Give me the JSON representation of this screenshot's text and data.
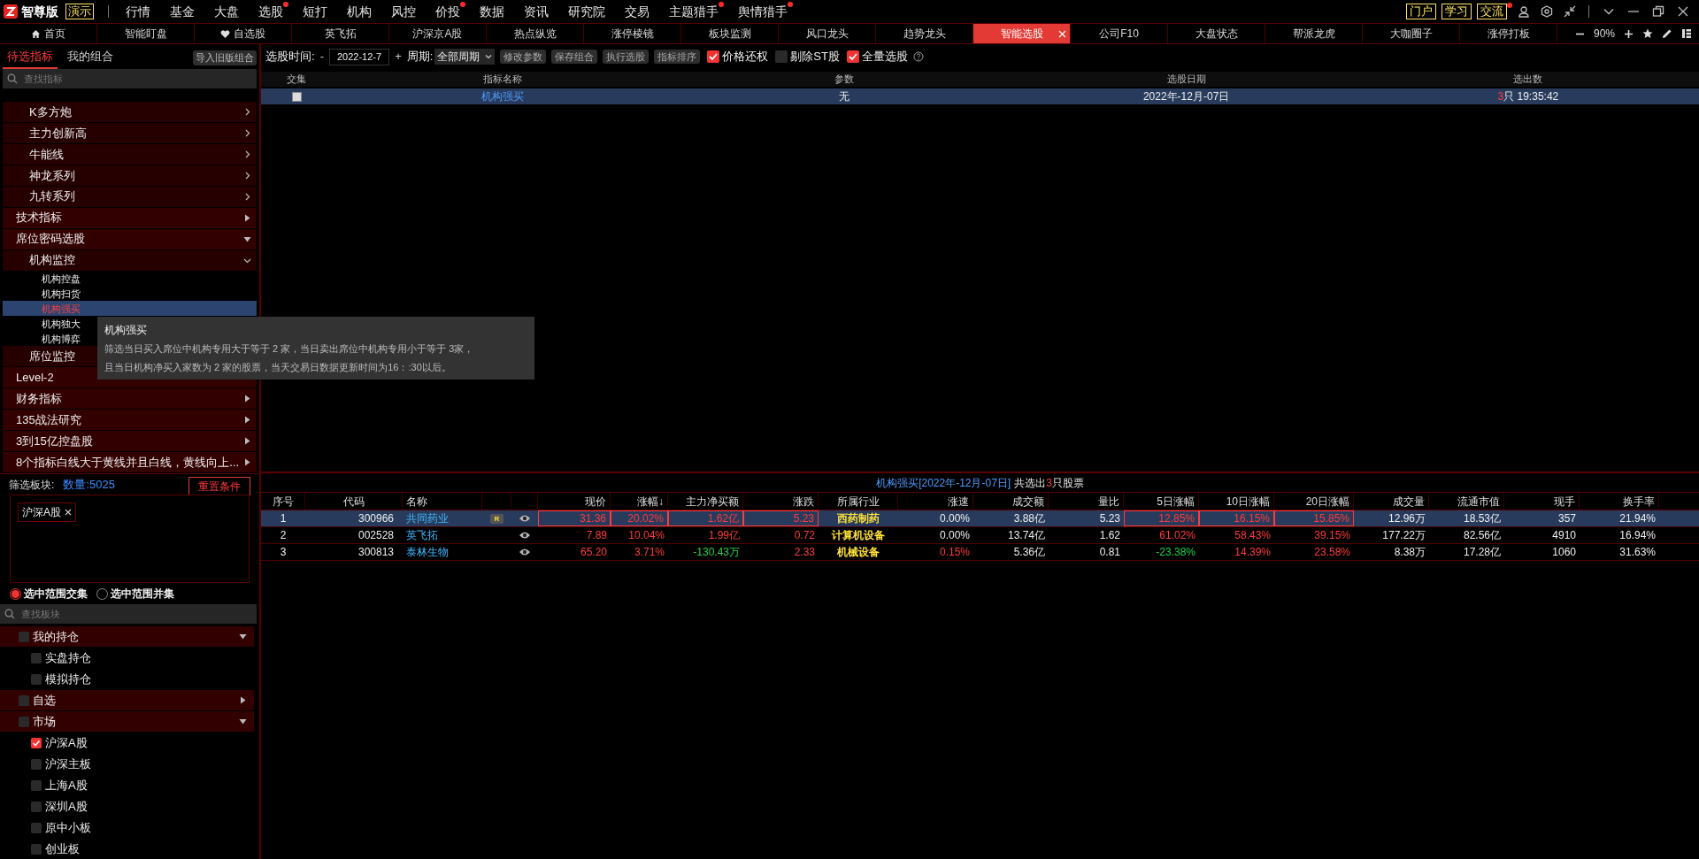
{
  "app": {
    "edition": "智尊版",
    "mode_badge": "演示"
  },
  "menu": [
    {
      "label": "行情",
      "dot": false
    },
    {
      "label": "基金",
      "dot": false
    },
    {
      "label": "大盘",
      "dot": false
    },
    {
      "label": "选股",
      "dot": true
    },
    {
      "label": "短打",
      "dot": false
    },
    {
      "label": "机构",
      "dot": false
    },
    {
      "label": "风控",
      "dot": false
    },
    {
      "label": "价投",
      "dot": true
    },
    {
      "label": "数据",
      "dot": false
    },
    {
      "label": "资讯",
      "dot": false
    },
    {
      "label": "研究院",
      "dot": false
    },
    {
      "label": "交易",
      "dot": false
    },
    {
      "label": "主题猎手",
      "dot": true
    },
    {
      "label": "舆情猎手",
      "dot": true
    }
  ],
  "top_links": [
    {
      "label": "门户",
      "dot": false
    },
    {
      "label": "学习",
      "dot": false
    },
    {
      "label": "交流",
      "dot": true
    }
  ],
  "tabs": [
    {
      "label": "首页",
      "kind": "home",
      "selected": false
    },
    {
      "label": "智能盯盘",
      "selected": false
    },
    {
      "label": "自选股",
      "kind": "favorite",
      "selected": false
    },
    {
      "label": "英飞拓",
      "selected": false
    },
    {
      "label": "沪深京A股",
      "selected": false
    },
    {
      "label": "热点纵览",
      "selected": false
    },
    {
      "label": "涨停棱镜",
      "selected": false
    },
    {
      "label": "板块监测",
      "selected": false
    },
    {
      "label": "风口龙头",
      "selected": false
    },
    {
      "label": "趋势龙头",
      "selected": false
    },
    {
      "label": "智能选股",
      "selected": true
    },
    {
      "label": "公司F10",
      "selected": false
    },
    {
      "label": "大盘状态",
      "selected": false
    },
    {
      "label": "帮派龙虎",
      "selected": false
    },
    {
      "label": "大咖圈子",
      "selected": false
    },
    {
      "label": "涨停打板",
      "selected": false
    }
  ],
  "zoom": {
    "value": "90%"
  },
  "left_tabs": [
    {
      "label": "待选指标",
      "selected": true
    },
    {
      "label": "我的组合",
      "selected": false
    }
  ],
  "import_button": "导入旧版组合",
  "indicator_search": {
    "placeholder": "查找指标"
  },
  "indicator_tree": [
    {
      "children": [
        {
          "label": "K多方炮",
          "expanded": false
        },
        {
          "label": "主力创新高",
          "expanded": false
        },
        {
          "label": "牛能线",
          "expanded": false
        },
        {
          "label": "神龙系列",
          "expanded": false
        },
        {
          "label": "九转系列",
          "expanded": false
        }
      ]
    },
    {
      "label": "技术指标",
      "expanded": false
    },
    {
      "label": "席位密码选股",
      "expanded": true,
      "children": [
        {
          "label": "机构监控",
          "expanded": true,
          "children": [
            {
              "label": "机构控盘",
              "selected": false
            },
            {
              "label": "机构扫货",
              "selected": false
            },
            {
              "label": "机构强买",
              "selected": true
            },
            {
              "label": "机构独大",
              "selected": false
            },
            {
              "label": "机构博弈",
              "selected": false
            }
          ]
        },
        {
          "label": "席位监控"
        }
      ]
    },
    {
      "label": "Level-2"
    },
    {
      "label": "财务指标",
      "expanded": false
    },
    {
      "label": "135战法研究",
      "expanded": false
    },
    {
      "label": "3到15亿控盘股",
      "expanded": false
    },
    {
      "label": "8个指标白线大于黄线并且白线，黄线向上...",
      "expanded": false
    }
  ],
  "tooltip": {
    "title": "机构强买",
    "lines": [
      "筛选当日买入席位中机构专用大于等于 2 家，当日卖出席位中机构专用小于等于 3家，",
      "且当日机构净买入家数为 2 家的股票，当天交易日数据更新时间为16：:30以后。"
    ]
  },
  "filter": {
    "label": "筛选板块:",
    "count": "数量:5025",
    "reset_button": "重置条件",
    "tags": [
      {
        "label": "沪深A股"
      }
    ],
    "modes": [
      {
        "label": "选中范围交集",
        "selected": true
      },
      {
        "label": "选中范围并集",
        "selected": false
      }
    ],
    "search": {
      "placeholder": "查找板块"
    }
  },
  "sector_tree": [
    {
      "label": "我的持仓",
      "checked": false,
      "expanded": true,
      "children": [
        {
          "label": "实盘持仓",
          "checked": false
        },
        {
          "label": "模拟持仓",
          "checked": false
        }
      ]
    },
    {
      "label": "自选",
      "checked": false,
      "expanded": false
    },
    {
      "label": "市场",
      "checked": false,
      "expanded": true,
      "children": [
        {
          "label": "沪深A股",
          "checked": true
        },
        {
          "label": "沪深主板",
          "checked": false
        },
        {
          "label": "上海A股",
          "checked": false
        },
        {
          "label": "深圳A股",
          "checked": false
        },
        {
          "label": "原中小板",
          "checked": false
        },
        {
          "label": "创业板",
          "checked": false
        }
      ]
    }
  ],
  "toolbar": {
    "date_label": "选股时间:",
    "minus": "-",
    "date": "2022-12-7",
    "plus": "+",
    "period_label": "周期:",
    "period": "全部周期",
    "buttons": [
      "修改参数",
      "保存组合",
      "执行选股",
      "指标排序"
    ],
    "options": [
      {
        "label": "价格还权",
        "checked": true
      },
      {
        "label": "剔除ST股",
        "checked": false
      },
      {
        "label": "全量选股",
        "checked": true
      }
    ]
  },
  "criteria_table": {
    "columns": [
      "交集",
      "指标名称",
      "参数",
      "选股日期",
      "选出数"
    ],
    "rows": [
      {
        "selected": true,
        "checked": false,
        "name": "机构强买",
        "params": "无",
        "date": "2022年-12月-07日",
        "count": "3",
        "unit": "只",
        "time": "19:35:42"
      }
    ]
  },
  "results": {
    "title": "机构强买[2022年-12月-07日]",
    "summary_prefix": "共选出",
    "count": "3",
    "summary_suffix": "只股票",
    "columns": [
      {
        "label": "序号",
        "kind": "index"
      },
      {
        "label": "代码",
        "kind": "code"
      },
      {
        "label": "名称",
        "kind": "name"
      },
      {
        "label": "现价",
        "kind": "num"
      },
      {
        "label": "涨幅↓",
        "kind": "num"
      },
      {
        "label": "主力净买额",
        "kind": "num"
      },
      {
        "label": "涨跌",
        "kind": "num"
      },
      {
        "label": "所属行业",
        "kind": "industry"
      },
      {
        "label": "涨速",
        "kind": "num"
      },
      {
        "label": "成交额",
        "kind": "num"
      },
      {
        "label": "量比",
        "kind": "num"
      },
      {
        "label": "5日涨幅",
        "kind": "num"
      },
      {
        "label": "10日涨幅",
        "kind": "num"
      },
      {
        "label": "20日涨幅",
        "kind": "num"
      },
      {
        "label": "成交量",
        "kind": "num"
      },
      {
        "label": "流通市值",
        "kind": "num"
      },
      {
        "label": "现手",
        "kind": "num"
      },
      {
        "label": "换手率",
        "kind": "num"
      }
    ],
    "rows": [
      {
        "selected": true,
        "badge": "R",
        "cells": [
          "1",
          "300966",
          "共同药业",
          {
            "text": "31.36",
            "color": "#ff3b3b"
          },
          {
            "text": "20.02%",
            "color": "#ff3b3b"
          },
          {
            "text": "1.62亿",
            "color": "#ff3b3b"
          },
          {
            "text": "5.23",
            "color": "#ff3b3b"
          },
          "西药制药",
          "0.00%",
          "3.88亿",
          "5.23",
          {
            "text": "12.85%",
            "color": "#ff3b3b"
          },
          {
            "text": "16.15%",
            "color": "#ff3b3b"
          },
          {
            "text": "15.85%",
            "color": "#ff3b3b"
          },
          "12.96万",
          "18.53亿",
          "357",
          "21.94%"
        ]
      },
      {
        "selected": false,
        "cells": [
          "2",
          "002528",
          "英飞拓",
          {
            "text": "7.89",
            "color": "#ff3b3b"
          },
          {
            "text": "10.04%",
            "color": "#ff3b3b"
          },
          {
            "text": "1.99亿",
            "color": "#ff3b3b"
          },
          {
            "text": "0.72",
            "color": "#ff3b3b"
          },
          "计算机设备",
          "0.00%",
          "13.74亿",
          "1.62",
          {
            "text": "61.02%",
            "color": "#ff3b3b"
          },
          {
            "text": "58.43%",
            "color": "#ff3b3b"
          },
          {
            "text": "39.15%",
            "color": "#ff3b3b"
          },
          "177.22万",
          "82.56亿",
          "4910",
          "16.94%"
        ]
      },
      {
        "selected": false,
        "cells": [
          "3",
          "300813",
          "泰林生物",
          {
            "text": "65.20",
            "color": "#ff3b3b"
          },
          {
            "text": "3.71%",
            "color": "#ff3b3b"
          },
          {
            "text": "-130.43万",
            "color": "#22d04a"
          },
          {
            "text": "2.33",
            "color": "#ff3b3b"
          },
          "机械设备",
          {
            "text": "0.15%",
            "color": "#ff3b3b"
          },
          "5.36亿",
          "0.81",
          {
            "text": "-23.38%",
            "color": "#22d04a"
          },
          {
            "text": "14.39%",
            "color": "#ff3b3b"
          },
          {
            "text": "23.58%",
            "color": "#ff3b3b"
          },
          "8.38万",
          "17.28亿",
          "1060",
          "31.63%"
        ]
      }
    ]
  }
}
